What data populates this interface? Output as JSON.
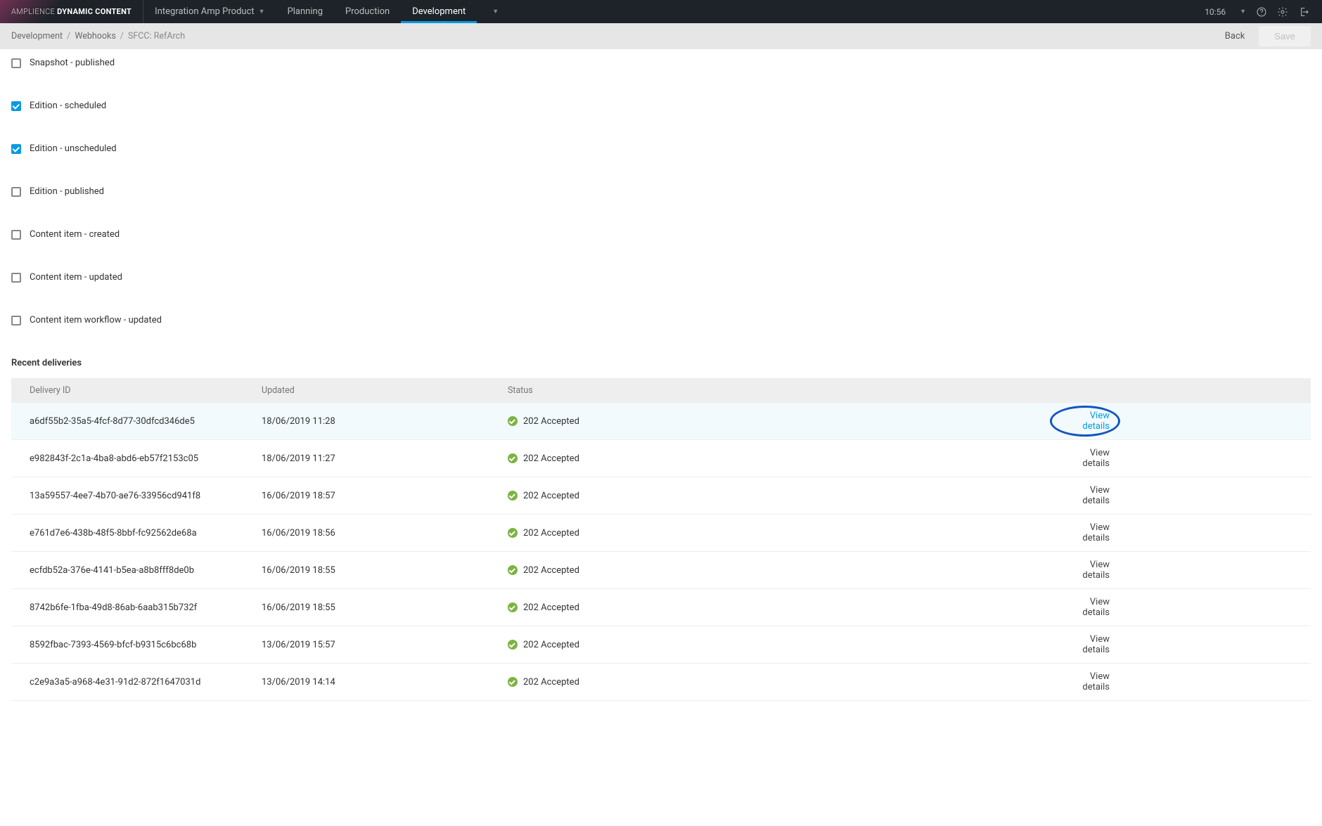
{
  "brand": {
    "light": "AMPLIENCE",
    "bold": "DYNAMIC CONTENT"
  },
  "nav": {
    "product": "Integration Amp Product",
    "items": [
      {
        "label": "Planning",
        "active": false
      },
      {
        "label": "Production",
        "active": false
      },
      {
        "label": "Development",
        "active": true
      }
    ]
  },
  "clock": "10:56",
  "breadcrumb": {
    "items": [
      "Development",
      "Webhooks"
    ],
    "current": "SFCC: RefArch",
    "back": "Back",
    "save": "Save"
  },
  "triggers": [
    {
      "label": "Snapshot - published",
      "checked": false
    },
    {
      "label": "Edition - scheduled",
      "checked": true
    },
    {
      "label": "Edition - unscheduled",
      "checked": true
    },
    {
      "label": "Edition - published",
      "checked": false
    },
    {
      "label": "Content item - created",
      "checked": false
    },
    {
      "label": "Content item - updated",
      "checked": false
    },
    {
      "label": "Content item workflow - updated",
      "checked": false
    }
  ],
  "deliveries": {
    "title": "Recent deliveries",
    "columns": {
      "id": "Delivery ID",
      "updated": "Updated",
      "status": "Status"
    },
    "view_label": "View details",
    "rows": [
      {
        "id": "a6df55b2-35a5-4fcf-8d77-30dfcd346de5",
        "updated": "18/06/2019 11:28",
        "status": "202 Accepted",
        "hover": true
      },
      {
        "id": "e982843f-2c1a-4ba8-abd6-eb57f2153c05",
        "updated": "18/06/2019 11:27",
        "status": "202 Accepted",
        "hover": false
      },
      {
        "id": "13a59557-4ee7-4b70-ae76-33956cd941f8",
        "updated": "16/06/2019 18:57",
        "status": "202 Accepted",
        "hover": false
      },
      {
        "id": "e761d7e6-438b-48f5-8bbf-fc92562de68a",
        "updated": "16/06/2019 18:56",
        "status": "202 Accepted",
        "hover": false
      },
      {
        "id": "ecfdb52a-376e-4141-b5ea-a8b8fff8de0b",
        "updated": "16/06/2019 18:55",
        "status": "202 Accepted",
        "hover": false
      },
      {
        "id": "8742b6fe-1fba-49d8-86ab-6aab315b732f",
        "updated": "16/06/2019 18:55",
        "status": "202 Accepted",
        "hover": false
      },
      {
        "id": "8592fbac-7393-4569-bfcf-b9315c6bc68b",
        "updated": "13/06/2019 15:57",
        "status": "202 Accepted",
        "hover": false
      },
      {
        "id": "c2e9a3a5-a968-4e31-91d2-872f1647031d",
        "updated": "13/06/2019 14:14",
        "status": "202 Accepted",
        "hover": false
      }
    ]
  }
}
